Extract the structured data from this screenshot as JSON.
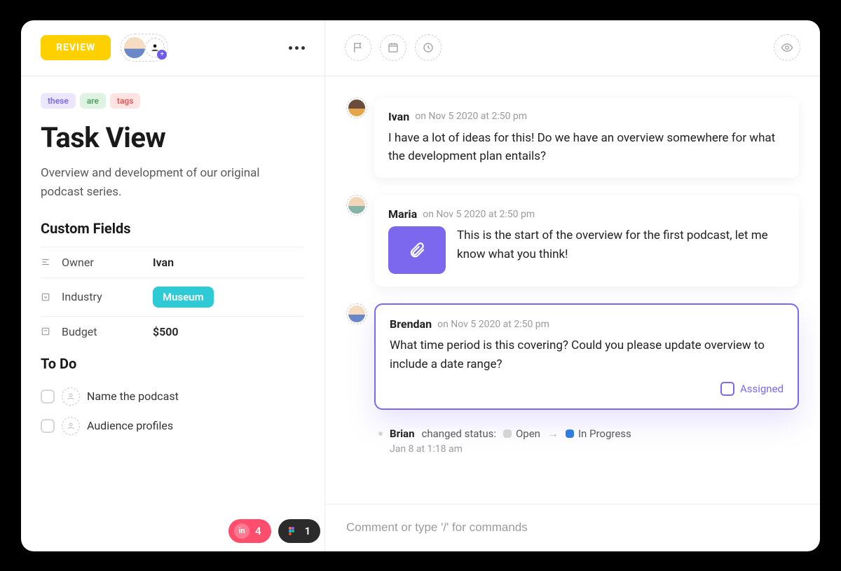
{
  "left": {
    "status": "REVIEW",
    "tags": [
      {
        "text": "these",
        "bg": "#ece7ff",
        "fg": "#7b68ee"
      },
      {
        "text": "are",
        "bg": "#dff3e2",
        "fg": "#46a758"
      },
      {
        "text": "tags",
        "bg": "#ffe2e2",
        "fg": "#e05a5a"
      }
    ],
    "title": "Task View",
    "description": "Overview and development of our original podcast series.",
    "custom_fields_label": "Custom Fields",
    "fields": {
      "owner": {
        "label": "Owner",
        "value": "Ivan"
      },
      "industry": {
        "label": "Industry",
        "value": "Museum"
      },
      "budget": {
        "label": "Budget",
        "value": "$500"
      }
    },
    "todo_label": "To Do",
    "todos": [
      "Name the podcast",
      "Audience profiles"
    ]
  },
  "comments": [
    {
      "author": "Ivan",
      "timestamp": "on Nov 5 2020 at 2:50 pm",
      "body": "I have a lot of ideas for this! Do we have an overview somewhere for what the development plan entails?",
      "avatar": "dark",
      "attachment": false,
      "highlight": false
    },
    {
      "author": "Maria",
      "timestamp": "on Nov 5 2020 at 2:50 pm",
      "body": "This is the start of the overview for the first podcast, let me know what you think!",
      "avatar": "tan",
      "attachment": true,
      "highlight": false
    },
    {
      "author": "Brendan",
      "timestamp": "on Nov 5 2020 at 2:50 pm",
      "body": "What time period is this covering? Could you please update overview to include a date range?",
      "avatar": "brown",
      "attachment": false,
      "highlight": true,
      "assigned_label": "Assigned"
    }
  ],
  "status_change": {
    "user": "Brian",
    "action": "changed status:",
    "from": {
      "label": "Open",
      "color": "#d4d4d4"
    },
    "to": {
      "label": "In Progress",
      "color": "#2f7de1"
    },
    "date": "Jan 8 at 1:18 am"
  },
  "footer": {
    "placeholder": "Comment or type '/' for commands"
  },
  "bottom_pills": {
    "invision_count": "4",
    "figma_count": "1"
  }
}
